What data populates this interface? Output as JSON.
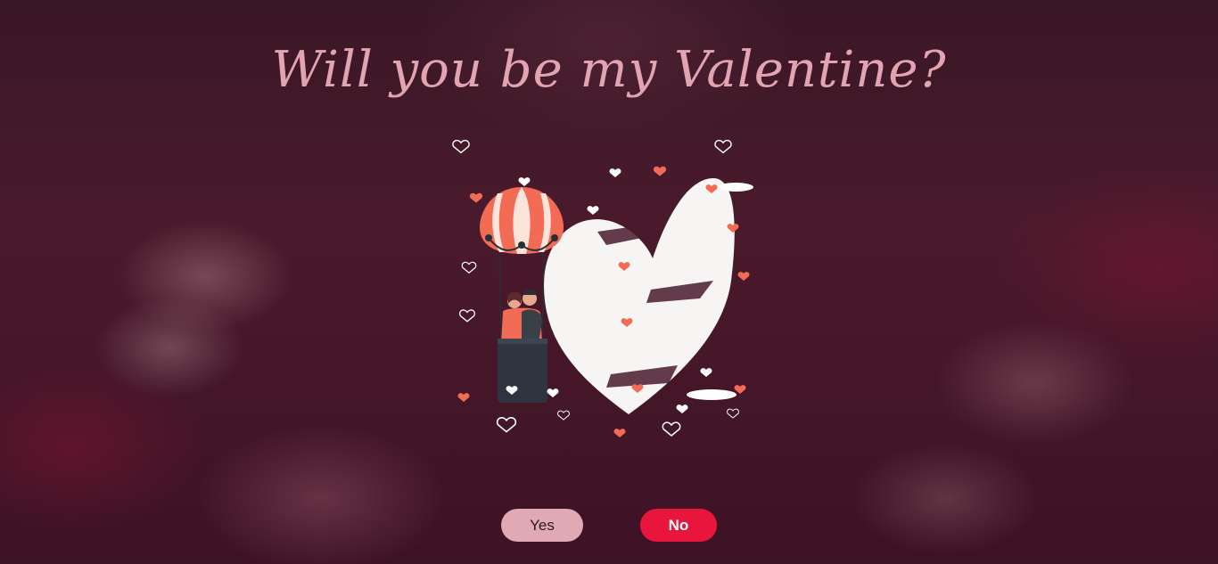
{
  "title": "Will you be my Valentine?",
  "buttons": {
    "yes_label": "Yes",
    "no_label": "No"
  },
  "illustration": {
    "name": "couple-in-hot-air-balloon-heart"
  },
  "colors": {
    "title": "#e3a4b1",
    "yes_bg": "#e1a9b4",
    "no_bg": "#e8163c",
    "accent": "#f26b55"
  }
}
